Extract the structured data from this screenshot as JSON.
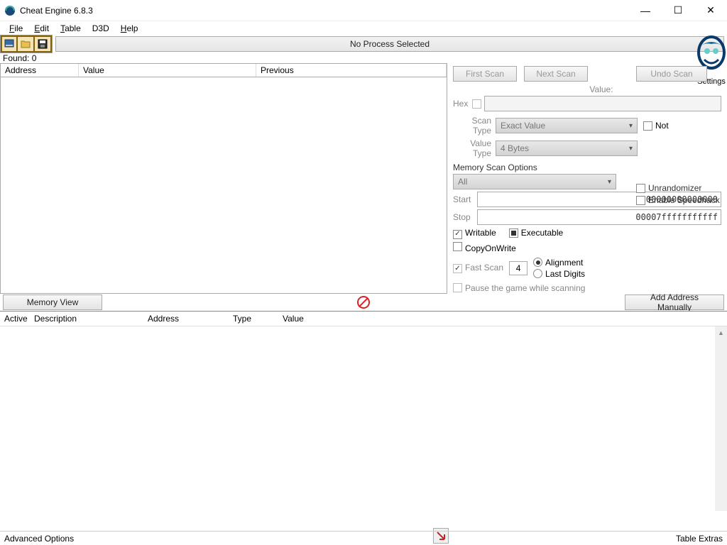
{
  "title": "Cheat Engine 6.8.3",
  "menu": {
    "items": [
      "File",
      "Edit",
      "Table",
      "D3D",
      "Help"
    ],
    "hotkeys": [
      0,
      0,
      0,
      -1,
      0
    ]
  },
  "process_label": "No Process Selected",
  "found": {
    "prefix": "Found: ",
    "count": "0"
  },
  "results_cols": {
    "address": "Address",
    "value": "Value",
    "previous": "Previous"
  },
  "buttons": {
    "first_scan": "First Scan",
    "next_scan": "Next Scan",
    "undo_scan": "Undo Scan",
    "memory_view": "Memory View",
    "add_manual": "Add Address Manually"
  },
  "labels": {
    "value": "Value:",
    "hex": "Hex",
    "scan_type": "Scan Type",
    "value_type": "Value Type",
    "not": "Not",
    "mem_opts": "Memory Scan Options",
    "start": "Start",
    "stop": "Stop",
    "writable": "Writable",
    "executable": "Executable",
    "copy_on_write": "CopyOnWrite",
    "fast_scan": "Fast Scan",
    "alignment": "Alignment",
    "last_digits": "Last Digits",
    "pause": "Pause the game while scanning",
    "unrandomizer": "Unrandomizer",
    "speedhack": "Enable Speedhack",
    "settings": "Settings"
  },
  "values": {
    "scan_type": "Exact Value",
    "value_type": "4 Bytes",
    "region": "All",
    "start_addr": "0000000000000000",
    "stop_addr": "00007fffffffffff",
    "fast_scan_val": "4"
  },
  "table_cols": {
    "active": "Active",
    "desc": "Description",
    "addr": "Address",
    "type": "Type",
    "value": "Value"
  },
  "status": {
    "left": "Advanced Options",
    "right": "Table Extras"
  }
}
